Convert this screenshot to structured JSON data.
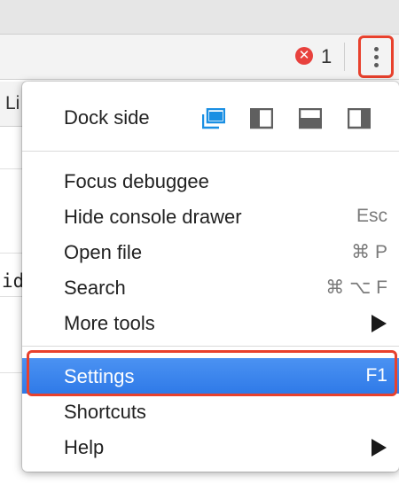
{
  "toolbar": {
    "error_icon_glyph": "✕",
    "error_count": "1",
    "more_button_icon": "kebab-vertical-icon"
  },
  "background": {
    "side_tab_text": "Li",
    "code_snippet_text": "id"
  },
  "menu": {
    "dock_side_label": "Dock side",
    "dock_options": [
      "undock-icon",
      "dock-left-icon",
      "dock-bottom-icon",
      "dock-right-icon"
    ],
    "dock_selected": "undock-icon",
    "items": [
      {
        "label": "Focus debuggee",
        "shortcut": ""
      },
      {
        "label": "Hide console drawer",
        "shortcut": "Esc"
      },
      {
        "label": "Open file",
        "shortcut": "⌘ P"
      },
      {
        "label": "Search",
        "shortcut": "⌘ ⌥ F"
      },
      {
        "label": "More tools",
        "submenu": true
      },
      {
        "label": "Settings",
        "shortcut": "F1",
        "selected": true
      },
      {
        "label": "Shortcuts",
        "shortcut": ""
      },
      {
        "label": "Help",
        "submenu": true
      }
    ]
  },
  "colors": {
    "highlight_red": "#e8412d",
    "selected_blue": "#3a84ee",
    "dock_active_blue": "#1a8fe3",
    "dock_inactive_gray": "#5f5f5f"
  }
}
